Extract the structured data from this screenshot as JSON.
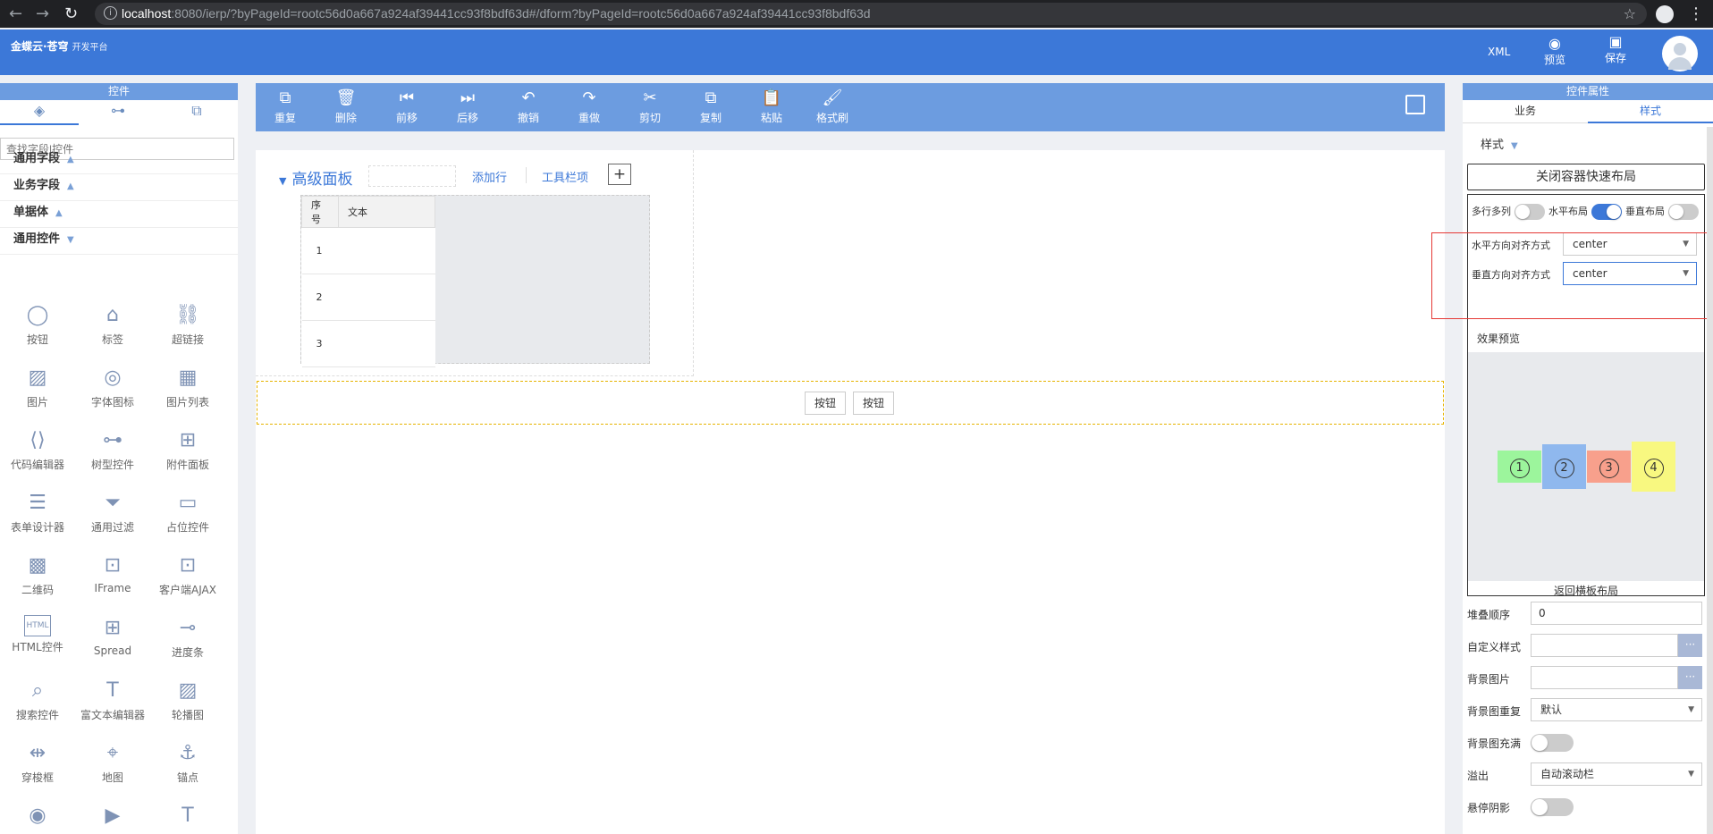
{
  "browser": {
    "url_host": "localhost",
    "url_rest": ":8080/ierp/?byPageId=rootc56d0a667a924af39441cc93f8bdf63d#/dform?byPageId=rootc56d0a667a924af39441cc93f8bdf63d"
  },
  "header": {
    "brand": "金蝶云·苍穹",
    "brand_sub": "开发平台",
    "xml_label": "XML",
    "preview_label": "预览",
    "save_label": "保存"
  },
  "left_panel": {
    "title": "控件",
    "search_placeholder": "查找字段|控件",
    "categories": [
      {
        "label": "通用字段"
      },
      {
        "label": "业务字段"
      },
      {
        "label": "单据体"
      },
      {
        "label": "通用控件"
      }
    ],
    "controls": [
      {
        "label": "按钮",
        "icon": "circle-button-icon",
        "glyph": "◯"
      },
      {
        "label": "标签",
        "icon": "tag-icon",
        "glyph": "⌂"
      },
      {
        "label": "超链接",
        "icon": "link-icon",
        "glyph": "⛓"
      },
      {
        "label": "图片",
        "icon": "image-icon",
        "glyph": "▨"
      },
      {
        "label": "字体图标",
        "icon": "font-icon-icon",
        "glyph": "◎"
      },
      {
        "label": "图片列表",
        "icon": "image-list-icon",
        "glyph": "▦"
      },
      {
        "label": "代码编辑器",
        "icon": "code-editor-icon",
        "glyph": "⟨⟩"
      },
      {
        "label": "树型控件",
        "icon": "tree-icon",
        "glyph": "⊶"
      },
      {
        "label": "附件面板",
        "icon": "attachment-panel-icon",
        "glyph": "⊞"
      },
      {
        "label": "表单设计器",
        "icon": "form-designer-icon",
        "glyph": "☰"
      },
      {
        "label": "通用过滤",
        "icon": "filter-icon",
        "glyph": "⏷"
      },
      {
        "label": "占位控件",
        "icon": "placeholder-icon",
        "glyph": "▭"
      },
      {
        "label": "二维码",
        "icon": "qrcode-icon",
        "glyph": "▩"
      },
      {
        "label": "IFrame",
        "icon": "iframe-icon",
        "glyph": "⊡"
      },
      {
        "label": "客户端AJAX",
        "icon": "ajax-icon",
        "glyph": "⊡"
      },
      {
        "label": "HTML控件",
        "icon": "html-icon",
        "glyph": "HTML"
      },
      {
        "label": "Spread",
        "icon": "spread-icon",
        "glyph": "⊞"
      },
      {
        "label": "进度条",
        "icon": "progress-icon",
        "glyph": "⊸"
      },
      {
        "label": "搜索控件",
        "icon": "search-control-icon",
        "glyph": "⌕"
      },
      {
        "label": "富文本编辑器",
        "icon": "richtext-icon",
        "glyph": "T"
      },
      {
        "label": "轮播图",
        "icon": "carousel-icon",
        "glyph": "▨"
      },
      {
        "label": "穿梭框",
        "icon": "transfer-icon",
        "glyph": "⇹"
      },
      {
        "label": "地图",
        "icon": "map-icon",
        "glyph": "⌖"
      },
      {
        "label": "锚点",
        "icon": "anchor-icon",
        "glyph": "⚓"
      },
      {
        "label": "",
        "icon": "audio-icon",
        "glyph": "◉"
      },
      {
        "label": "",
        "icon": "video-icon",
        "glyph": "▶"
      },
      {
        "label": "",
        "icon": "text-icon",
        "glyph": "T"
      }
    ]
  },
  "toolbar": [
    {
      "label": "重复",
      "icon": "duplicate-icon",
      "glyph": "⧉"
    },
    {
      "label": "删除",
      "icon": "delete-icon",
      "glyph": "🗑"
    },
    {
      "label": "前移",
      "icon": "move-forward-icon",
      "glyph": "⏮"
    },
    {
      "label": "后移",
      "icon": "move-backward-icon",
      "glyph": "⏭"
    },
    {
      "label": "撤销",
      "icon": "undo-icon",
      "glyph": "↶"
    },
    {
      "label": "重做",
      "icon": "redo-icon",
      "glyph": "↷"
    },
    {
      "label": "剪切",
      "icon": "cut-icon",
      "glyph": "✂"
    },
    {
      "label": "复制",
      "icon": "copy-icon",
      "glyph": "⧉"
    },
    {
      "label": "粘贴",
      "icon": "paste-icon",
      "glyph": "📋"
    },
    {
      "label": "格式刷",
      "icon": "format-brush-icon",
      "glyph": "🖌"
    }
  ],
  "canvas": {
    "panel_title": "高级面板",
    "add_row": "添加行",
    "toolbar_item": "工具栏项",
    "plus": "+",
    "grid_headers": [
      "序号",
      "文本"
    ],
    "grid_rows": [
      "1",
      "2",
      "3"
    ],
    "buttons": [
      "按钮",
      "按钮"
    ]
  },
  "right_panel": {
    "title": "控件属性",
    "tabs": [
      "业务",
      "样式"
    ],
    "active_tab": "样式",
    "style_header": "样式",
    "close_layout_button": "关闭容器快速布局",
    "toggles": [
      {
        "label": "多行多列",
        "on": false
      },
      {
        "label": "水平布局",
        "on": true
      },
      {
        "label": "垂直布局",
        "on": false
      }
    ],
    "h_align_label": "水平方向对齐方式",
    "h_align_value": "center",
    "v_align_label": "垂直方向对齐方式",
    "v_align_value": "center",
    "preview_label": "效果预览",
    "preview_boxes": [
      {
        "num": "1",
        "color": "#9cf59c"
      },
      {
        "num": "2",
        "color": "#8fb8ee"
      },
      {
        "num": "3",
        "color": "#f8a08c"
      },
      {
        "num": "4",
        "color": "#f8f880"
      }
    ],
    "back_label": "返回横板布局",
    "props": [
      {
        "label": "堆叠顺序",
        "value": "0",
        "kind": "input"
      },
      {
        "label": "自定义样式",
        "value": "",
        "kind": "dots"
      },
      {
        "label": "背景图片",
        "value": "",
        "kind": "dots"
      },
      {
        "label": "背景图重复",
        "value": "默认",
        "kind": "select"
      },
      {
        "label": "背景图充满",
        "value": "",
        "kind": "toggle"
      },
      {
        "label": "溢出",
        "value": "自动滚动栏",
        "kind": "select"
      },
      {
        "label": "悬停阴影",
        "value": "",
        "kind": "toggle"
      }
    ]
  }
}
